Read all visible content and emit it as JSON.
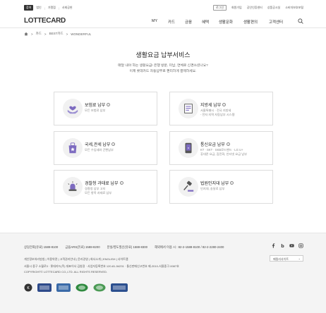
{
  "util": {
    "left": [
      "참여",
      "법인",
      "가맹점",
      "사회공헌"
    ],
    "right_badge": "로그인",
    "right": [
      "회원가입",
      "공인인증센터",
      "상품공시실",
      "소비자보호포털"
    ]
  },
  "header": {
    "logo": "LOTTECARD",
    "nav": [
      "MY",
      "카드",
      "금융",
      "혜택",
      "생활문화",
      "생활편의",
      "고객센터"
    ]
  },
  "breadcrumb": [
    "카드",
    "BEST카드",
    "WONDERFUL"
  ],
  "main": {
    "title": "생활요금 납부서비스",
    "desc_line1": "매달 내야 하는 생활요금! 은행 방문, 미납, 연체로 신경쓰셨나요?",
    "desc_line2": "이제 롯데카드 자동납부로 편리하게 결제하세요."
  },
  "cards": [
    {
      "title": "보험료 납부",
      "sub1": "모든 보험료 납부",
      "sub2": "",
      "icon": "heart-hands-icon"
    },
    {
      "title": "지방세 납부",
      "sub1": "서울특별시 · 전국 지방세",
      "sub2": "- 전자 지역 자동납부 시스템",
      "icon": "tax-document-icon"
    },
    {
      "title": "국세,관세 납부",
      "sub1": "모든 수입세와 간편납부",
      "sub2": "",
      "icon": "customs-bag-icon"
    },
    {
      "title": "통신요금 납부",
      "sub1": "KT · SKT · SKB로드밴드 · LG U+",
      "sub2": "휴대폰 요금, 집전화, 인터넷 요금 납부",
      "icon": "mobile-phone-icon"
    },
    {
      "title": "경찰청 과태료 납부",
      "sub1": "경찰청 납부 고지",
      "sub2": "모든 항목 과태료 납부",
      "icon": "police-light-icon"
    },
    {
      "title": "법원인지대 납부",
      "sub1": "인지대, 송달료 납부",
      "sub2": "",
      "icon": "gavel-icon"
    }
  ],
  "footer": {
    "phones": [
      "상담전화(유료) 1588-8100",
      "금융ARS(유료) 1588-8200",
      "분실/영도질신(유료) 1588-8300",
      "해외에서 이용 시 : 82-2-1588-8100 / 82-2-2280-2400"
    ],
    "line1": "개인정보처리방침 | 이용약관 | 고객권리안내 | 윤리경영 | 회사소개 | ENGLISH | 사이트맵",
    "line2": "서울시 중구 소월로3 · 롯데카드(주) 대표이사 김창권 · 사업자등록번호 120-81-54231 · 통신판매신고번호 제-2010-서울중구-0087호",
    "line3": "COPYRIGHT© LOTTECARD CO.,LTD. ALL RIGHTS RESERVED.",
    "family_site": "패밀리사이트",
    "sns": [
      "facebook-icon",
      "blog-icon",
      "youtube-icon",
      "instagram-icon"
    ]
  },
  "colors": {
    "accent": "#6a5fb6",
    "icon_purple": "#7d6bc0"
  }
}
